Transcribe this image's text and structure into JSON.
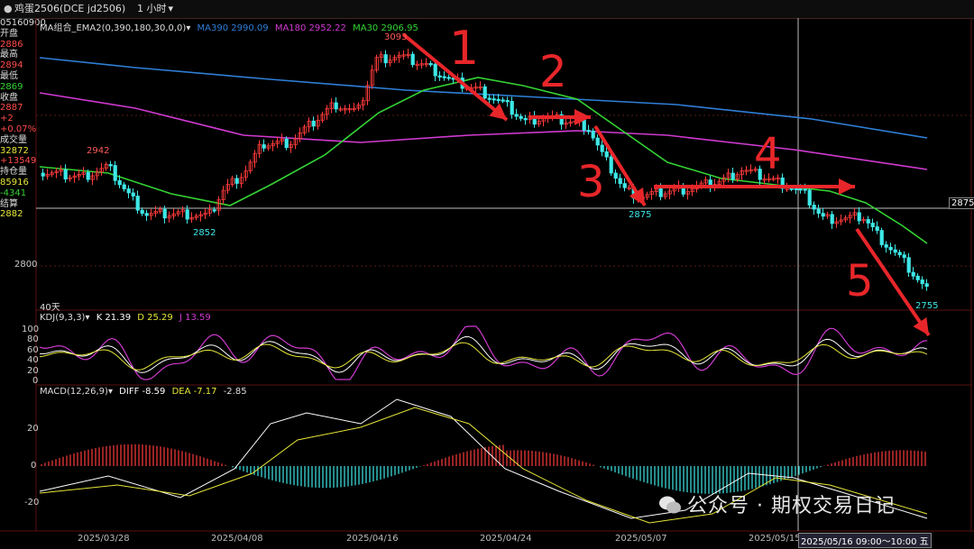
{
  "toolbar": {
    "bullet": "●",
    "symbol_name": "鸡蛋2506(DCE jd2506)",
    "period": "1 小时",
    "period_caret": "▾"
  },
  "sidebar": {
    "time": "05160900",
    "rows": [
      {
        "label": "开盘",
        "value": "2886"
      },
      {
        "label": "最高",
        "value": "2894"
      },
      {
        "label": "最低",
        "value": "2869"
      },
      {
        "label": "收盘",
        "value": "2887"
      },
      {
        "label": "",
        "value": "+2"
      },
      {
        "label": "",
        "value": "+0.07%"
      },
      {
        "label": "成交量",
        "value": "32872"
      },
      {
        "label": "",
        "value": "+13549"
      },
      {
        "label": "持仓量",
        "value": "85916"
      },
      {
        "label": "",
        "value": "-4341"
      },
      {
        "label": "结算",
        "value": "2882"
      }
    ]
  },
  "main_panel": {
    "ma_legend": {
      "group": "MA组合_EMA2(0,390,180,30,0,0)",
      "caret": "▾",
      "ma390": "MA390 2990.09",
      "ma180": "MA180 2952.22",
      "ma30": "MA30 2906.95"
    },
    "price_labels": {
      "high": "3093",
      "left_high": "2942",
      "low1": "2852",
      "low2": "2875",
      "last": "2755",
      "crosshair_price": "2875",
      "axis_2800": "2800"
    },
    "annotations": [
      "1",
      "2",
      "3",
      "4",
      "5"
    ],
    "period_count": "40天"
  },
  "kdj_panel": {
    "name": "KDJ(9,3,3)",
    "caret": "▾",
    "k": "K 21.39",
    "d": "D 25.29",
    "j": "J 13.59",
    "y_ticks": [
      "100",
      "80",
      "60",
      "40",
      "20",
      "0"
    ]
  },
  "macd_panel": {
    "name": "MACD(12,26,9)",
    "caret": "▾",
    "diff": "DIFF -8.59",
    "dea": "DEA -7.17",
    "macd": "-2.85",
    "y_ticks": [
      "20",
      "0",
      "-20"
    ]
  },
  "date_axis": [
    "2025/03/28",
    "2025/04/08",
    "2025/04/16",
    "2025/04/24",
    "2025/05/07",
    "2025/05/15"
  ],
  "crosshair_date": "2025/05/16 09:00～10:00 五",
  "watermark": "公众号 · 期权交易日记",
  "colors": {
    "up": "#ff3b3b",
    "down": "#3ee8e8",
    "ma390": "#2f7fd8",
    "ma180": "#d03ad0",
    "ma30": "#34d334",
    "annotation": "#e8262a",
    "kdj_k": "#ffffff",
    "kdj_d": "#e6e63a",
    "kdj_j": "#d03ad0"
  }
}
